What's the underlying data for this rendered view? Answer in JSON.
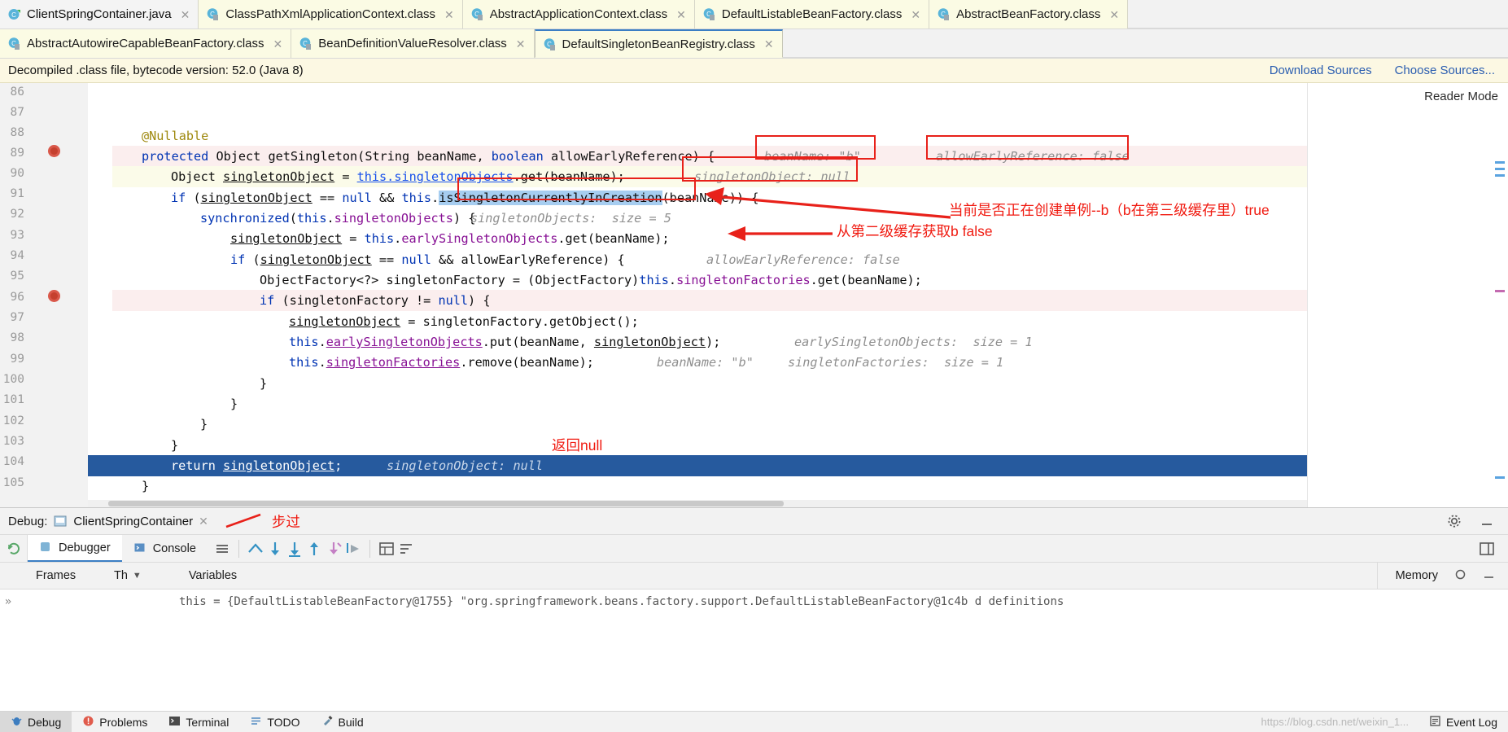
{
  "tabs_row1": [
    {
      "label": "ClientSpringContainer.java",
      "icon": "java-class-icon",
      "style": "plain"
    },
    {
      "label": "ClassPathXmlApplicationContext.class",
      "icon": "class-file-icon",
      "style": "yellow"
    },
    {
      "label": "AbstractApplicationContext.class",
      "icon": "class-file-icon",
      "style": "yellow"
    },
    {
      "label": "DefaultListableBeanFactory.class",
      "icon": "class-file-icon",
      "style": "yellow"
    },
    {
      "label": "AbstractBeanFactory.class",
      "icon": "class-file-icon",
      "style": "yellow"
    }
  ],
  "tabs_row2": [
    {
      "label": "AbstractAutowireCapableBeanFactory.class",
      "icon": "class-file-icon",
      "style": "yellow"
    },
    {
      "label": "BeanDefinitionValueResolver.class",
      "icon": "class-file-icon",
      "style": "yellow"
    },
    {
      "label": "DefaultSingletonBeanRegistry.class",
      "icon": "class-file-icon",
      "style": "selected"
    }
  ],
  "notice": {
    "message": "Decompiled .class file, bytecode version: 52.0 (Java 8)",
    "download_sources": "Download Sources",
    "choose_sources": "Choose Sources..."
  },
  "editor": {
    "reader_mode": "Reader Mode",
    "line_numbers": [
      "86",
      "87",
      "88",
      "89",
      "90",
      "91",
      "92",
      "93",
      "94",
      "95",
      "96",
      "97",
      "98",
      "99",
      "100",
      "101",
      "102",
      "103",
      "104",
      "105"
    ],
    "code": {
      "l85_close": "}",
      "l87": "@Nullable",
      "l88": "protected Object getSingleton(String beanName, boolean allowEarlyReference) {",
      "l89": "Object singletonObject = this.singletonObjects.get(beanName);",
      "l90": "if (singletonObject == null && this.isSingletonCurrentlyInCreation(beanName)) {",
      "l91": "synchronized(this.singletonObjects) {",
      "l92": "singletonObject = this.earlySingletonObjects.get(beanName);",
      "l93": "if (singletonObject == null && allowEarlyReference) {",
      "l94": "ObjectFactory<?> singletonFactory = (ObjectFactory)this.singletonFactories.get(beanName);",
      "l95": "if (singletonFactory != null) {",
      "l96": "singletonObject = singletonFactory.getObject();",
      "l97": "this.earlySingletonObjects.put(beanName, singletonObject);",
      "l98": "this.singletonFactories.remove(beanName);",
      "l99": "}",
      "l100": "}",
      "l101": "}",
      "l102": "}",
      "l104": "return singletonObject;",
      "l105": "}"
    },
    "inline_values": {
      "l88_beanName": "beanName: \"b\"",
      "l88_allowEarly": "allowEarlyReference: false",
      "l89_singletonObject": "singletonObject: null",
      "l91_singletonObjects": "singletonObjects:  size = 5",
      "l93_allowEarly": "allowEarlyReference: false",
      "l97_early": "earlySingletonObjects:  size = 1",
      "l98_beanName": "beanName: \"b\"",
      "l98_factories": "singletonFactories:  size = 1",
      "l104_singletonObject": "singletonObject: null"
    },
    "annotations": [
      {
        "text": "当前是否正在创建单例--b（b在第三级缓存里）true",
        "name": "annotation-is-creating"
      },
      {
        "text": "从第二级缓存获取b false",
        "name": "annotation-second-cache"
      },
      {
        "text": "返回null",
        "name": "annotation-return-null"
      },
      {
        "text": "步过",
        "name": "annotation-step-over"
      }
    ],
    "selected_token": "isSingletonCurrentlyInCreation"
  },
  "debug": {
    "label": "Debug:",
    "config_name": "ClientSpringContainer",
    "tabs": [
      {
        "label": "Debugger",
        "icon": "debugger-icon",
        "selected": true
      },
      {
        "label": "Console",
        "icon": "console-icon",
        "selected": false
      }
    ],
    "columns": {
      "frames": "Frames",
      "threads": "Th",
      "variables": "Variables",
      "memory": "Memory"
    },
    "variables_row": "this = {DefaultListableBeanFactory@1755} \"org.springframework.beans.factory.support.DefaultListableBeanFactory@1c4b d definitions"
  },
  "statusbar": {
    "items": [
      {
        "label": "Debug",
        "icon": "debug-icon",
        "active": true
      },
      {
        "label": "Problems",
        "icon": "problems-icon",
        "active": false
      },
      {
        "label": "Terminal",
        "icon": "terminal-icon",
        "active": false
      },
      {
        "label": "TODO",
        "icon": "todo-icon",
        "active": false
      },
      {
        "label": "Build",
        "icon": "build-icon",
        "active": false
      }
    ],
    "event_log": "Event Log",
    "watermark": "https://blog.csdn.net/weixin_1..."
  },
  "colors": {
    "accent_blue": "#2a5db0",
    "annotation_red": "#f01a10",
    "selection_blue": "#265a9e",
    "keyword_blue": "#0033b3",
    "field_purple": "#871094",
    "tab_yellow": "#fbfbe4"
  }
}
